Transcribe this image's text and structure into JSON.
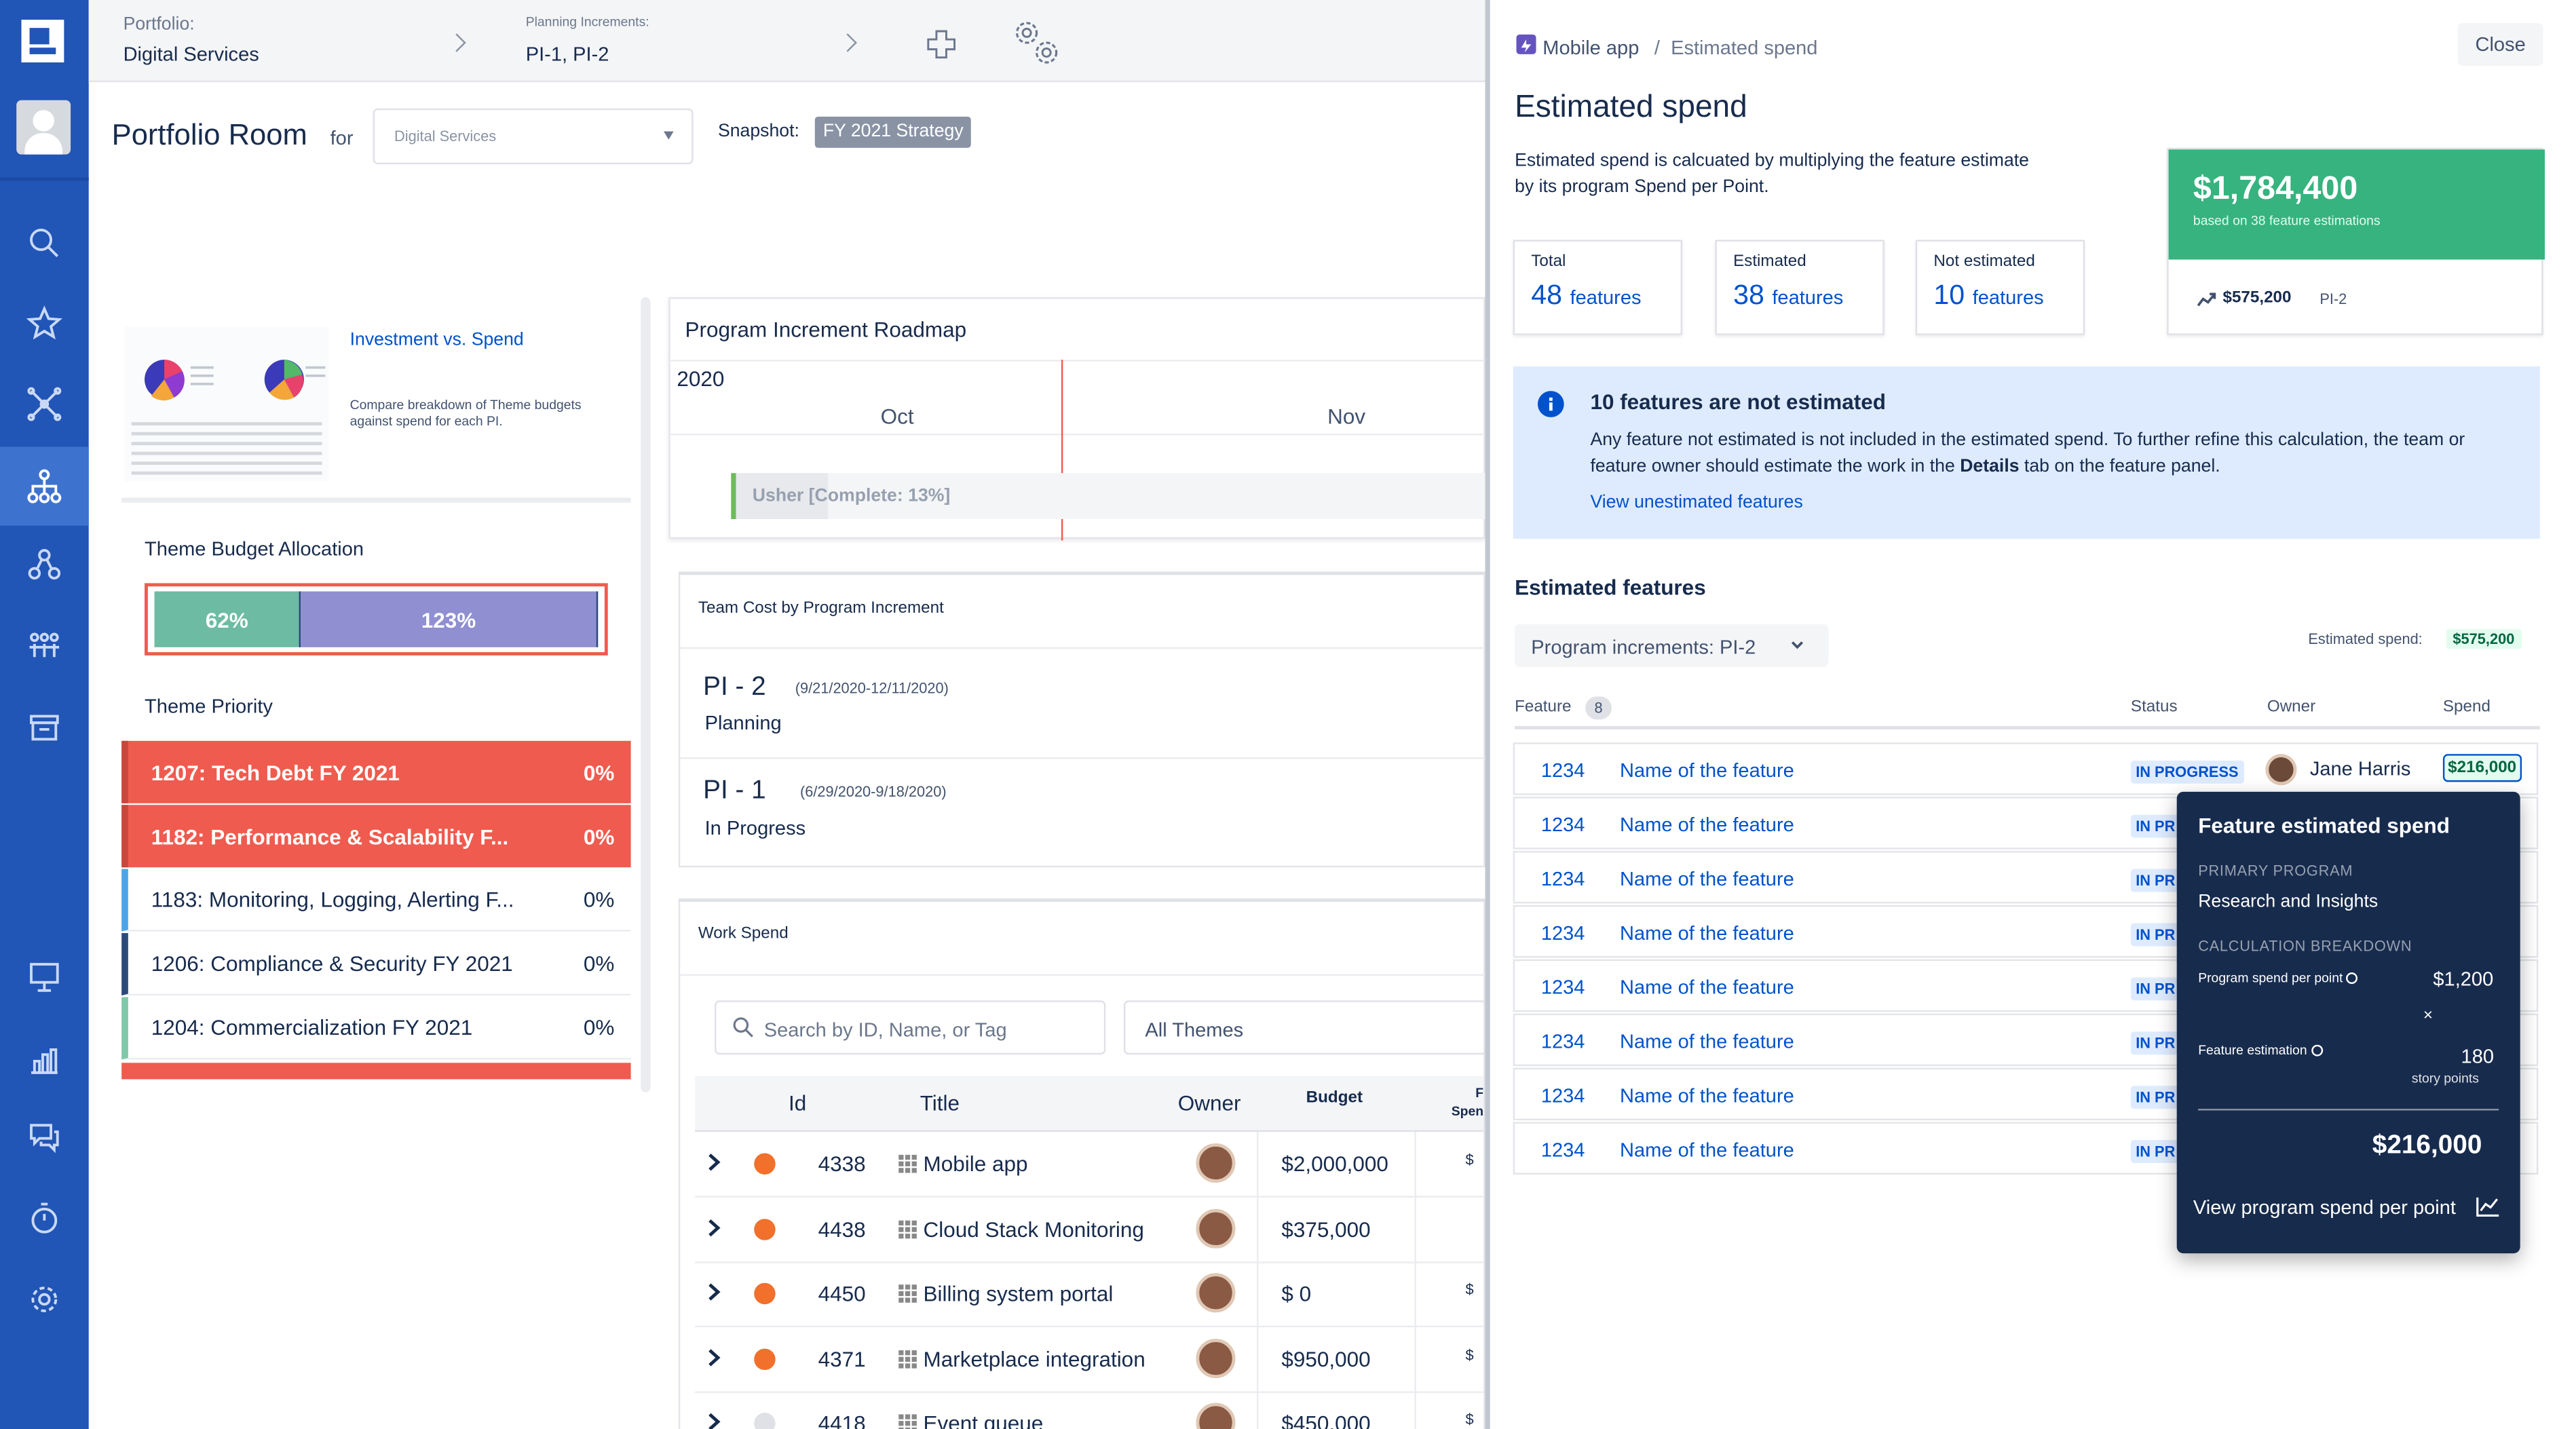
{
  "topbar": {
    "portfolio_label": "Portfolio:",
    "portfolio_value": "Digital Services",
    "increments_label": "Planning Increments:",
    "increments_value": "PI-1, PI-2"
  },
  "portfolio_room": {
    "title": "Portfolio Room",
    "for_label": "for",
    "select_value": "Digital Services",
    "snapshot_label": "Snapshot:",
    "snapshot_value": "FY 2021 Strategy"
  },
  "investment_card": {
    "title": "Investment vs. Spend",
    "description": "Compare breakdown of Theme budgets against spend for each PI."
  },
  "theme_budget": {
    "title": "Theme Budget Allocation",
    "segments": [
      {
        "label": "62%",
        "share": 0.33,
        "color": "#6dbba2"
      },
      {
        "label": "123%",
        "share": 0.67,
        "color": "#8f8fd1"
      }
    ]
  },
  "theme_priority": {
    "title": "Theme Priority",
    "rows": [
      {
        "name": "1207: Tech Debt FY 2021",
        "pct": "0%",
        "style": "red",
        "accent": "#c9463b"
      },
      {
        "name": "1182: Performance & Scalability F...",
        "pct": "0%",
        "style": "red",
        "accent": "#c9463b"
      },
      {
        "name": "1183: Monitoring, Logging, Alerting F...",
        "pct": "0%",
        "style": "white",
        "accent": "#4ba5e8"
      },
      {
        "name": "1206: Compliance & Security FY 2021",
        "pct": "0%",
        "style": "white",
        "accent": "#2b4a7a"
      },
      {
        "name": "1204: Commercialization FY 2021",
        "pct": "0%",
        "style": "white",
        "accent": "#7fc8a9"
      }
    ]
  },
  "roadmap": {
    "title": "Program Increment Roadmap",
    "year": "2020",
    "months": [
      "Oct",
      "Nov"
    ],
    "bar_label": "Usher [Complete: 13%]",
    "bar_progress": 0.13
  },
  "team_cost": {
    "title": "Team Cost by Program Increment",
    "items": [
      {
        "name": "PI - 2",
        "dates": "(9/21/2020-12/11/2020)",
        "status": "Planning"
      },
      {
        "name": "PI - 1",
        "dates": "(6/29/2020-9/18/2020)",
        "status": "In Progress"
      }
    ]
  },
  "work_spend": {
    "title": "Work Spend",
    "search_placeholder": "Search by ID, Name, or Tag",
    "themes_value": "All Themes",
    "columns": {
      "id": "Id",
      "title": "Title",
      "owner": "Owner",
      "budget": "Budget",
      "spend": "F Spen"
    },
    "rows": [
      {
        "id": "4338",
        "title": "Mobile app",
        "budget": "$2,000,000",
        "dot": "#f0702c",
        "spend": "$"
      },
      {
        "id": "4438",
        "title": "Cloud Stack Monitoring",
        "budget": "$375,000",
        "dot": "#f0702c",
        "spend": ""
      },
      {
        "id": "4450",
        "title": "Billing system portal",
        "budget": "$ 0",
        "dot": "#f0702c",
        "spend": "$"
      },
      {
        "id": "4371",
        "title": "Marketplace integration",
        "budget": "$950,000",
        "dot": "#f0702c",
        "spend": "$"
      },
      {
        "id": "4418",
        "title": "Event queue",
        "budget": "$450,000",
        "dot": "#dfe1e6",
        "spend": "$"
      }
    ]
  },
  "panel": {
    "breadcrumb_parent": "Mobile app",
    "breadcrumb_sep": "/",
    "breadcrumb_current": "Estimated spend",
    "close_label": "Close",
    "title": "Estimated spend",
    "description": "Estimated spend is calcuated by multiplying the feature estimate by its program Spend per Point.",
    "stats": [
      {
        "label": "Total",
        "count": "48",
        "unit": "features"
      },
      {
        "label": "Estimated",
        "count": "38",
        "unit": "features"
      },
      {
        "label": "Not estimated",
        "count": "10",
        "unit": "features"
      }
    ],
    "total_card": {
      "amount": "$1,784,400",
      "sub": "based on 38 feature estimations",
      "pi_amount": "$575,200",
      "pi_label": "PI-2",
      "color": "#36b37e"
    },
    "info": {
      "title": "10 features are not estimated",
      "body_1": "Any feature not estimated is not included in the estimated spend. To further refine this calculation, the team or feature owner should estimate the work in the ",
      "body_bold": "Details",
      "body_2": " tab on the feature panel.",
      "link": "View unestimated features"
    },
    "estimated_features_title": "Estimated features",
    "pi_filter_label": "Program increments:",
    "pi_filter_value": "PI-2",
    "estimated_spend_label": "Estimated spend:",
    "estimated_spend_value": "$575,200",
    "columns": {
      "feature": "Feature",
      "feature_count": "8",
      "status": "Status",
      "owner": "Owner",
      "spend": "Spend"
    },
    "rows": [
      {
        "id": "1234",
        "name": "Name of the feature",
        "status": "IN PROGRESS",
        "owner": "Jane Harris",
        "spend": "$216,000"
      },
      {
        "id": "1234",
        "name": "Name of the feature",
        "status": "IN PR"
      },
      {
        "id": "1234",
        "name": "Name of the feature",
        "status": "IN PR"
      },
      {
        "id": "1234",
        "name": "Name of the feature",
        "status": "IN PR"
      },
      {
        "id": "1234",
        "name": "Name of the feature",
        "status": "IN PR"
      },
      {
        "id": "1234",
        "name": "Name of the feature",
        "status": "IN PR"
      },
      {
        "id": "1234",
        "name": "Name of the feature",
        "status": "IN PR"
      },
      {
        "id": "1234",
        "name": "Name of the feature",
        "status": "IN PR"
      }
    ]
  },
  "tooltip": {
    "title": "Feature estimated spend",
    "primary_label": "PRIMARY PROGRAM",
    "primary_value": "Research and Insights",
    "breakdown_label": "CALCULATION BREAKDOWN",
    "spend_per_point_label": "Program spend per point",
    "spend_per_point_value": "$1,200",
    "times": "×",
    "estimation_label": "Feature estimation",
    "estimation_value": "180",
    "estimation_unit": "story points",
    "result": "$216,000",
    "link": "View program spend per point"
  }
}
